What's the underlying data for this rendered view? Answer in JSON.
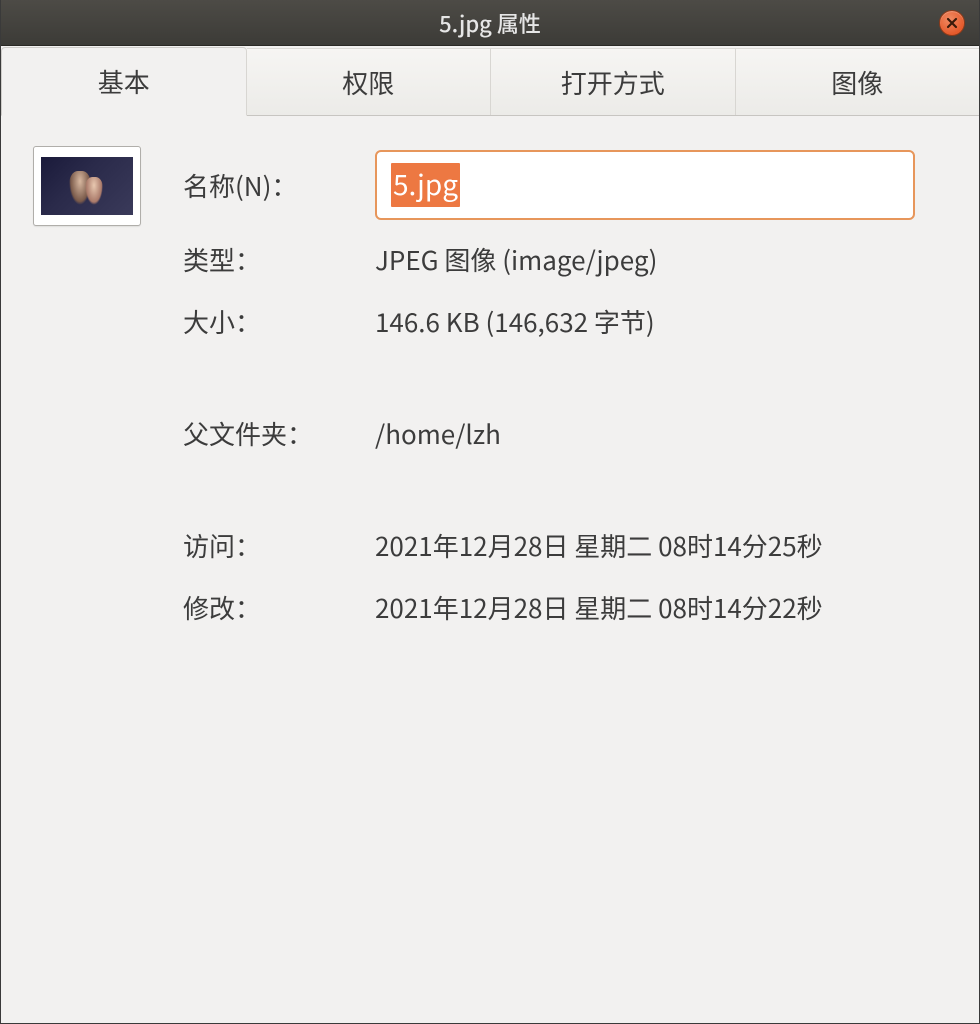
{
  "window": {
    "title": "5.jpg 属性"
  },
  "tabs": {
    "basic": "基本",
    "permissions": "权限",
    "open_with": "打开方式",
    "image": "图像"
  },
  "labels": {
    "name": "名称(N)：",
    "type": "类型：",
    "size": "大小：",
    "parent": "父文件夹：",
    "accessed": "访问：",
    "modified": "修改："
  },
  "values": {
    "name": "5.jpg",
    "type": "JPEG 图像 (image/jpeg)",
    "size": "146.6 KB (146,632 字节)",
    "parent": "/home/lzh",
    "accessed": "2021年12月28日 星期二 08时14分25秒",
    "modified": "2021年12月28日 星期二 08时14分22秒"
  }
}
